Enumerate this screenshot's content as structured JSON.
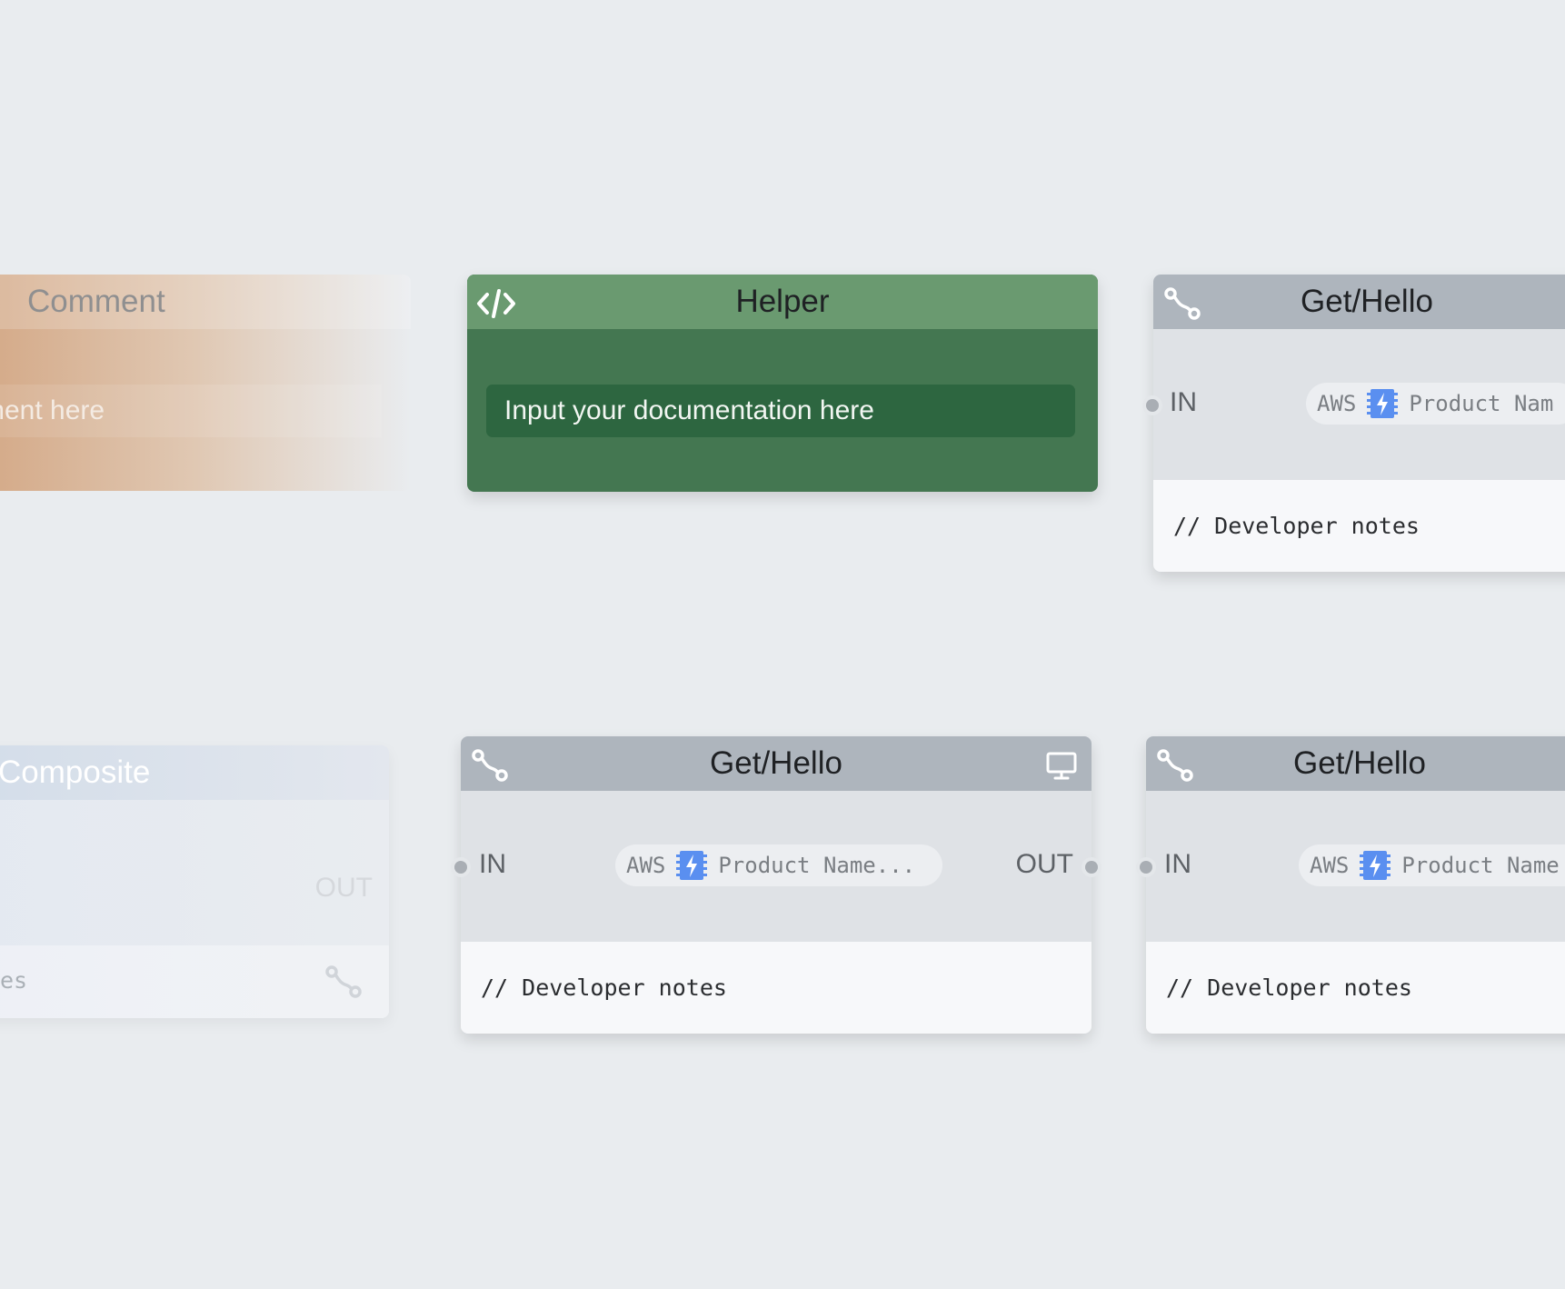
{
  "canvas": {
    "background": "#e9ecef"
  },
  "comment_node": {
    "title": "Comment",
    "input_value": "ment here",
    "accent": "#d4a987"
  },
  "helper_node": {
    "title": "Helper",
    "icon": "code-icon",
    "input_value": "Input your documentation here",
    "colors": {
      "header": "#6a9a70",
      "body": "#447751",
      "field": "#2d6640"
    }
  },
  "composite_node": {
    "title": "Composite",
    "out_label": "OUT",
    "notes_value": "es",
    "icon": "route-icon"
  },
  "endpoint_nodes": [
    {
      "title": "Get/Hello",
      "in_label": "IN",
      "chip_provider": "AWS",
      "chip_text": "Product Nam",
      "notes": "// Developer notes",
      "icon": "route-icon"
    },
    {
      "title": "Get/Hello",
      "in_label": "IN",
      "out_label": "OUT",
      "chip_provider": "AWS",
      "chip_text": "Product Name...",
      "notes": "// Developer notes",
      "icon": "route-icon",
      "action_icon": "monitor-icon"
    },
    {
      "title": "Get/Hello",
      "in_label": "IN",
      "chip_provider": "AWS",
      "chip_text": "Product Name",
      "notes": "// Developer notes",
      "icon": "route-icon"
    }
  ],
  "icon_colors": {
    "lambda": "#5a8ff0",
    "route": "#ffffff",
    "monitor": "#ffffff"
  }
}
